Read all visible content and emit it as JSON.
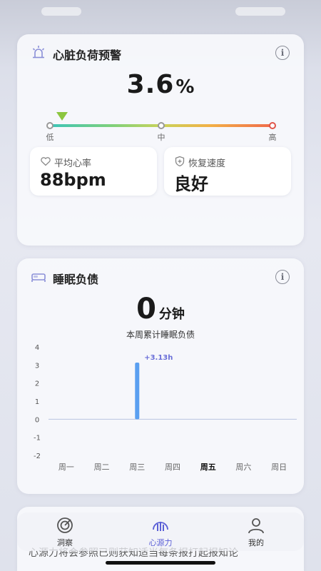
{
  "heart_card": {
    "title": "心脏负荷预警",
    "percent_value": "3.6",
    "percent_unit": "%",
    "gauge": {
      "labels": [
        "低",
        "中",
        "高"
      ],
      "level": 0.036,
      "colors": [
        "#3cc4b8",
        "#7fd07a",
        "#c9d35a",
        "#f2b046",
        "#f06a4a"
      ],
      "marker_color": "#8cc63f"
    },
    "stats": [
      {
        "label": "平均心率",
        "value": "88bpm",
        "icon": "heart-outline-icon"
      },
      {
        "label": "恢复速度",
        "value": "良好",
        "icon": "shield-plus-icon"
      }
    ]
  },
  "sleep_card": {
    "title": "睡眠负债",
    "value": "0",
    "unit": "分钟",
    "subtitle": "本周累计睡眠负债",
    "icon": "bed-icon"
  },
  "chart_data": {
    "type": "bar",
    "categories": [
      "周一",
      "周二",
      "周三",
      "周四",
      "周五",
      "周六",
      "周日"
    ],
    "highlighted_category": "周五",
    "values": [
      0,
      0,
      3.13,
      0,
      0,
      0,
      0
    ],
    "data_labels": {
      "周三": "+3.13h"
    },
    "y_ticks": [
      "4",
      "3",
      "2",
      "1",
      "0",
      "-1",
      "-2"
    ],
    "ylim": [
      -2,
      4
    ],
    "grid": false,
    "bar_color": "#5a9ff0",
    "label_color": "#6a6fd8"
  },
  "tabs": [
    {
      "label": "洞察",
      "icon": "insight-icon",
      "active": false
    },
    {
      "label": "心源力",
      "icon": "heart-power-icon",
      "active": true
    },
    {
      "label": "我的",
      "icon": "user-icon",
      "active": false
    }
  ],
  "background_text": "心源力将会参照已则获知适当每条报打起报知论"
}
